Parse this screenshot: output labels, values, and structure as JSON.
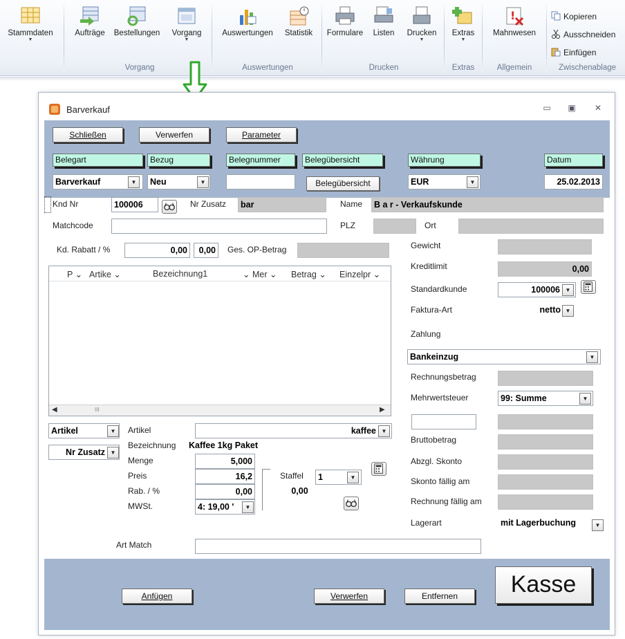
{
  "ribbon": {
    "buttons": {
      "stammdaten": "Stammdaten",
      "auftraege": "Aufträge",
      "bestellungen": "Bestellungen",
      "vorgang": "Vorgang",
      "auswertungen": "Auswertungen",
      "statistik": "Statistik",
      "formulare": "Formulare",
      "listen": "Listen",
      "drucken": "Drucken",
      "extras": "Extras",
      "mahnwesen": "Mahnwesen"
    },
    "clipboard": {
      "kopieren": "Kopieren",
      "ausschneiden": "Ausschneiden",
      "einfuegen": "Einfügen"
    },
    "groups": {
      "vorgang": "Vorgang",
      "auswertungen": "Auswertungen",
      "drucken": "Drucken",
      "extras": "Extras",
      "allgemein": "Allgemein",
      "zwischenablage": "Zwischenablage"
    }
  },
  "window": {
    "title": "Barverkauf",
    "controls": {
      "minimize": "▭",
      "restore": "▣",
      "close": "✕"
    }
  },
  "toolbar": {
    "schliessen": "Schließen",
    "verwerfen": "Verwerfen",
    "parameter": "Parameter"
  },
  "header": {
    "belegart_label": "Belegart",
    "belegart_value": "Barverkauf",
    "bezug_label": "Bezug",
    "bezug_value": "Neu",
    "belegnummer_label": "Belegnummer",
    "belegnummer_value": "",
    "beleguebersicht_label": "Belegübersicht",
    "beleguebersicht_button": "Belegübersicht",
    "waehrung_label": "Währung",
    "waehrung_value": "EUR",
    "datum_label": "Datum",
    "datum_value": "25.02.2013"
  },
  "customer": {
    "kndnr_label": "Knd Nr",
    "kndnr_value": "100006",
    "nrzusatz_label": "Nr Zusatz",
    "nrzusatz_value": "bar",
    "name_label": "Name",
    "name_value": "B a r - Verkaufskunde",
    "matchcode_label": "Matchcode",
    "plz_label": "PLZ",
    "ort_label": "Ort",
    "rabatt_label": "Kd. Rabatt / %",
    "rabatt_value": "0,00",
    "rabatt_value2": "0,00",
    "opbetrag_label": "Ges. OP-Betrag"
  },
  "grid": {
    "columns": [
      "P",
      "Artike",
      "Bezeichnung1",
      "Mer",
      "Betrag",
      "Einzelpr"
    ],
    "scroll_thumb": "III"
  },
  "article": {
    "artikel_combo": "Artikel",
    "nrzusatz_combo": "Nr Zusatz",
    "artikel_label": "Artikel",
    "artikel_value": "kaffee",
    "bezeichnung_label": "Bezeichnung",
    "bezeichnung_value": "Kaffee 1kg Paket",
    "menge_label": "Menge",
    "menge_value": "5,000",
    "preis_label": "Preis",
    "preis_value": "16,2",
    "staffel_label": "Staffel",
    "staffel_value": "1",
    "rab_label": "Rab. / %",
    "rab_value": "0,00",
    "rab_value2": "0,00",
    "mwst_label": "MWSt.",
    "mwst_value": "4: 19,00 '",
    "artmatch_label": "Art Match"
  },
  "right_panel": {
    "gewicht_label": "Gewicht",
    "kreditlimit_label": "Kreditlimit",
    "kreditlimit_value": "0,00",
    "standardkunde_label": "Standardkunde",
    "standardkunde_value": "100006",
    "faktura_label": "Faktura-Art",
    "faktura_value": "netto",
    "zahlung_label": "Zahlung",
    "zahlung_value": "Bankeinzug",
    "rechnungsbetrag_label": "Rechnungsbetrag",
    "mwst_label": "Mehrwertsteuer",
    "mwst_value": "99: Summe",
    "brutto_label": "Bruttobetrag",
    "skonto_label": "Abzgl. Skonto",
    "skonto_faellig_label": "Skonto fällig am",
    "rechnung_faellig_label": "Rechnung fällig am",
    "lagerart_label": "Lagerart",
    "lagerart_value": "mit Lagerbuchung"
  },
  "footer": {
    "anfuegen": "Anfügen",
    "verwerfen": "Verwerfen",
    "entfernen": "Entfernen",
    "kasse": "Kasse"
  },
  "colors": {
    "band": "#a4b6cf",
    "label_bg": "#bff7e4",
    "readonly_gray": "#c8c8c8",
    "arrow_green": "#2fa82f"
  }
}
